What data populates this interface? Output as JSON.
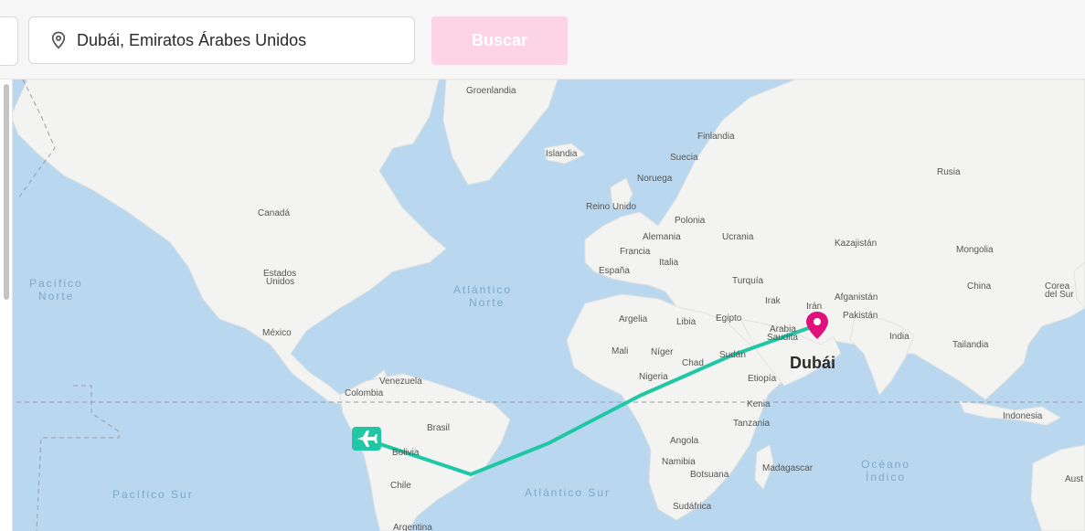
{
  "search": {
    "value": "Dubái, Emiratos Árabes Unidos",
    "button_label": "Buscar",
    "pin_icon": "location-pin-icon"
  },
  "map": {
    "destination_label": "Dubái",
    "route_color": "#1fc7a5",
    "marker_color": "#e0117a",
    "origin_icon": "airplane-icon",
    "destination_icon": "map-marker-icon",
    "country_labels": {
      "greenland": "Groenlandia",
      "finland": "Finlandia",
      "iceland": "Islandia",
      "sweden": "Suecia",
      "russia": "Rusia",
      "norway": "Noruega",
      "uk": "Reino Unido",
      "poland": "Polonia",
      "canada": "Canadá",
      "germany": "Alemania",
      "ukraine": "Ucrania",
      "kazakhstan": "Kazajistán",
      "mongolia": "Mongolia",
      "france": "Francia",
      "italy": "Italia",
      "spain": "España",
      "us1": "Estados",
      "us2": "Unidos",
      "turkey": "Turquía",
      "china": "China",
      "korea1": "Corea",
      "korea2": "del Sur",
      "iraq": "Irak",
      "afghanistan": "Afganistán",
      "iran": "Irán",
      "pakistan": "Pakistán",
      "algeria": "Argelia",
      "libya": "Libia",
      "egypt": "Egipto",
      "saudi1": "Arabia",
      "saudi2": "Saudita",
      "mexico": "México",
      "india": "India",
      "mali": "Mali",
      "niger": "Níger",
      "sudan": "Sudán",
      "thailand": "Tailandia",
      "chad": "Chad",
      "venezuela": "Venezuela",
      "nigeria": "Nigeria",
      "ethiopia": "Etiopía",
      "colombia": "Colombia",
      "kenya": "Kenia",
      "indonesia": "Indonesia",
      "tanzania": "Tanzania",
      "brazil": "Brasil",
      "bolivia": "Bolivia",
      "angola": "Angola",
      "namibia": "Namibia",
      "madagascar": "Madagascar",
      "botswana": "Botsuana",
      "chile": "Chile",
      "south_africa": "Sudáfrica",
      "argentina": "Argentina",
      "australia": "Aust"
    },
    "ocean_labels": {
      "north_pacific_1": "Pacífico",
      "north_pacific_2": "Norte",
      "north_atlantic_1": "Atlántico",
      "north_atlantic_2": "Norte",
      "south_pacific": "Pacífico Sur",
      "south_atlantic": "Atlántico Sur",
      "indian_1": "Océano",
      "indian_2": "Índico"
    }
  }
}
